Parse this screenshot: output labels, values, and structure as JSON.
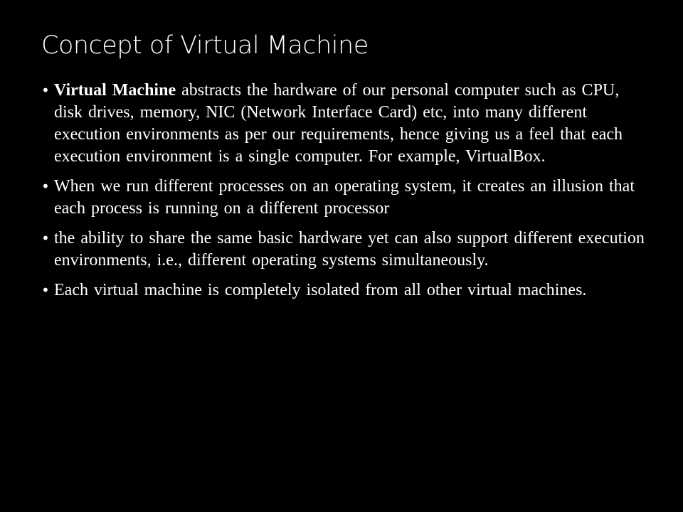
{
  "slide": {
    "title": "Concept of Virtual Machine",
    "bullet_glyph": "•",
    "bullets": [
      {
        "term": "Virtual Machine",
        "text": " abstracts the hardware of our personal computer such as CPU, disk drives, memory, NIC (Network Interface Card) etc, into many different execution environments as per our requirements, hence giving us a feel that each execution environment is a single computer. For example, VirtualBox."
      },
      {
        "text": "When we run different processes on an operating system, it creates an illusion that each process is running on a different processor"
      },
      {
        "text": "the ability to share the same basic hardware yet can also support different execution environments, i.e., different operating systems simultaneously."
      },
      {
        "text": "Each virtual machine is completely isolated from all other virtual machines."
      }
    ]
  },
  "colors": {
    "background": "#000000",
    "text": "#ffffff"
  }
}
